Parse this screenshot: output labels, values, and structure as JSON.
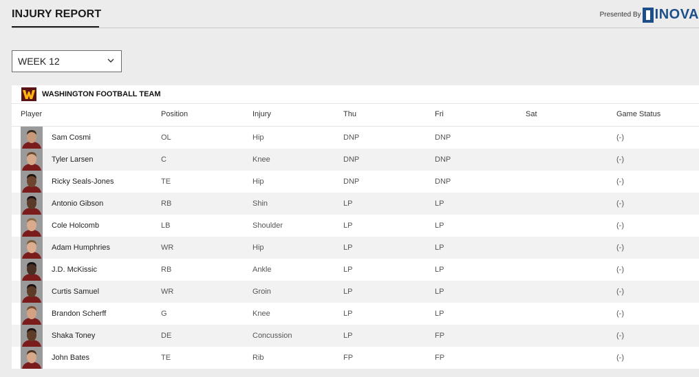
{
  "header": {
    "title": "INJURY REPORT",
    "presented_by": "Presented By",
    "sponsor": "INOVA",
    "sponsor_color": "#1c4e8a"
  },
  "week_select": {
    "value": "WEEK 12"
  },
  "team": {
    "name": "WASHINGTON FOOTBALL TEAM",
    "logo_color": "#5a1414",
    "logo_accent": "#ffb612"
  },
  "columns": {
    "player": "Player",
    "position": "Position",
    "injury": "Injury",
    "thu": "Thu",
    "fri": "Fri",
    "sat": "Sat",
    "status": "Game Status"
  },
  "players": [
    {
      "name": "Sam Cosmi",
      "position": "OL",
      "injury": "Hip",
      "thu": "DNP",
      "fri": "DNP",
      "sat": "",
      "status": "(-)",
      "skin": "#c89a7a",
      "hair": "#3b2a1e"
    },
    {
      "name": "Tyler Larsen",
      "position": "C",
      "injury": "Knee",
      "thu": "DNP",
      "fri": "DNP",
      "sat": "",
      "status": "(-)",
      "skin": "#d6a98a",
      "hair": "#6b4a2f"
    },
    {
      "name": "Ricky Seals-Jones",
      "position": "TE",
      "injury": "Hip",
      "thu": "DNP",
      "fri": "DNP",
      "sat": "",
      "status": "(-)",
      "skin": "#6e4630",
      "hair": "#1f1410"
    },
    {
      "name": "Antonio Gibson",
      "position": "RB",
      "injury": "Shin",
      "thu": "LP",
      "fri": "LP",
      "sat": "",
      "status": "(-)",
      "skin": "#5a3a28",
      "hair": "#1a1210"
    },
    {
      "name": "Cole Holcomb",
      "position": "LB",
      "injury": "Shoulder",
      "thu": "LP",
      "fri": "LP",
      "sat": "",
      "status": "(-)",
      "skin": "#d9ab8c",
      "hair": "#8a6a44"
    },
    {
      "name": "Adam Humphries",
      "position": "WR",
      "injury": "Hip",
      "thu": "LP",
      "fri": "LP",
      "sat": "",
      "status": "(-)",
      "skin": "#dcae8e",
      "hair": "#7a5a3c"
    },
    {
      "name": "J.D. McKissic",
      "position": "RB",
      "injury": "Ankle",
      "thu": "LP",
      "fri": "LP",
      "sat": "",
      "status": "(-)",
      "skin": "#4a3024",
      "hair": "#141010"
    },
    {
      "name": "Curtis Samuel",
      "position": "WR",
      "injury": "Groin",
      "thu": "LP",
      "fri": "LP",
      "sat": "",
      "status": "(-)",
      "skin": "#5c3b28",
      "hair": "#1a1210"
    },
    {
      "name": "Brandon Scherff",
      "position": "G",
      "injury": "Knee",
      "thu": "LP",
      "fri": "LP",
      "sat": "",
      "status": "(-)",
      "skin": "#d4a283",
      "hair": "#7a4e30"
    },
    {
      "name": "Shaka Toney",
      "position": "DE",
      "injury": "Concussion",
      "thu": "LP",
      "fri": "FP",
      "sat": "",
      "status": "(-)",
      "skin": "#5e3c2a",
      "hair": "#1a1210"
    },
    {
      "name": "John Bates",
      "position": "TE",
      "injury": "Rib",
      "thu": "FP",
      "fri": "FP",
      "sat": "",
      "status": "(-)",
      "skin": "#d8a88a",
      "hair": "#4a3424"
    }
  ]
}
